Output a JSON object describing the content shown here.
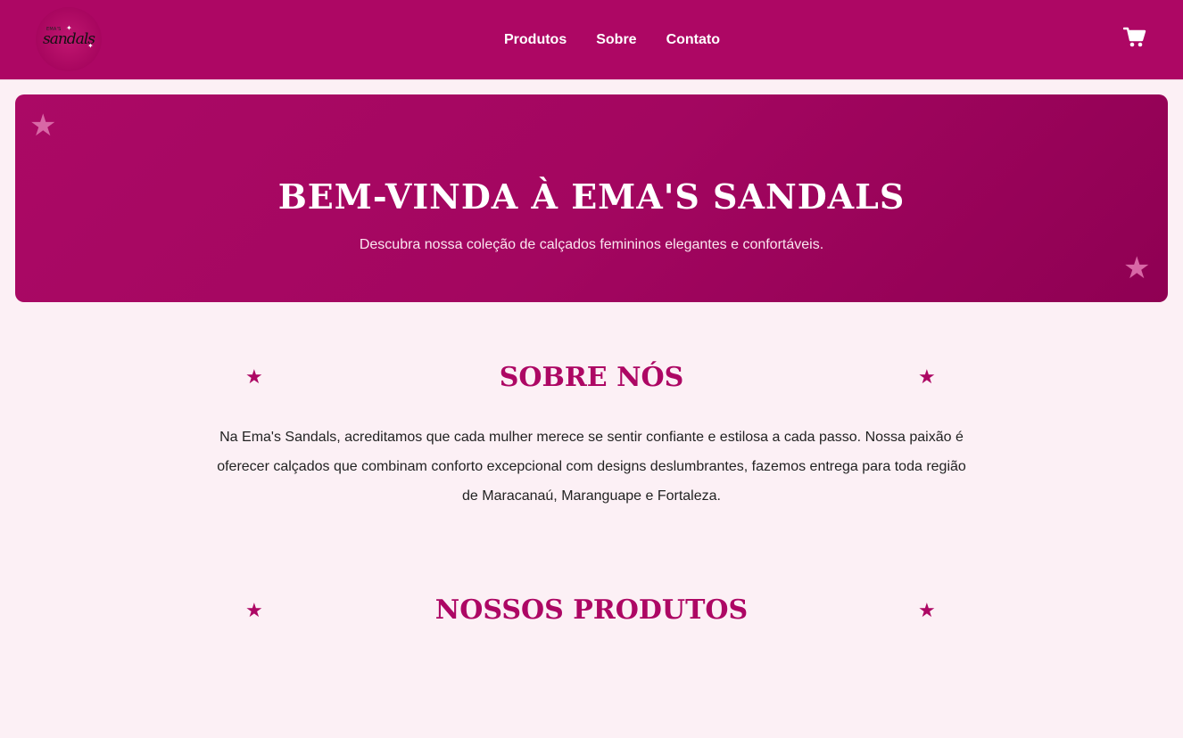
{
  "header": {
    "logo": {
      "small_text": "EMA'S",
      "main_text": "sandals"
    },
    "nav": [
      {
        "label": "Produtos"
      },
      {
        "label": "Sobre"
      },
      {
        "label": "Contato"
      }
    ],
    "cart_icon": "cart-icon"
  },
  "hero": {
    "title": "BEM-VINDA À EMA'S SANDALS",
    "subtitle": "Descubra nossa coleção de calçados femininos elegantes e confortáveis."
  },
  "about": {
    "title": "SOBRE NÓS",
    "text": "Na Ema's Sandals, acreditamos que cada mulher merece se sentir confiante e estilosa a cada passo. Nossa paixão é oferecer calçados que combinam conforto excepcional com designs deslumbrantes, fazemos entrega para toda região de Maracanaú, Maranguape e Fortaleza."
  },
  "products": {
    "title": "NOSSOS PRODUTOS"
  },
  "colors": {
    "primary": "#ad0764",
    "background": "#fcf0f5",
    "hero_star": "#d868a6"
  }
}
